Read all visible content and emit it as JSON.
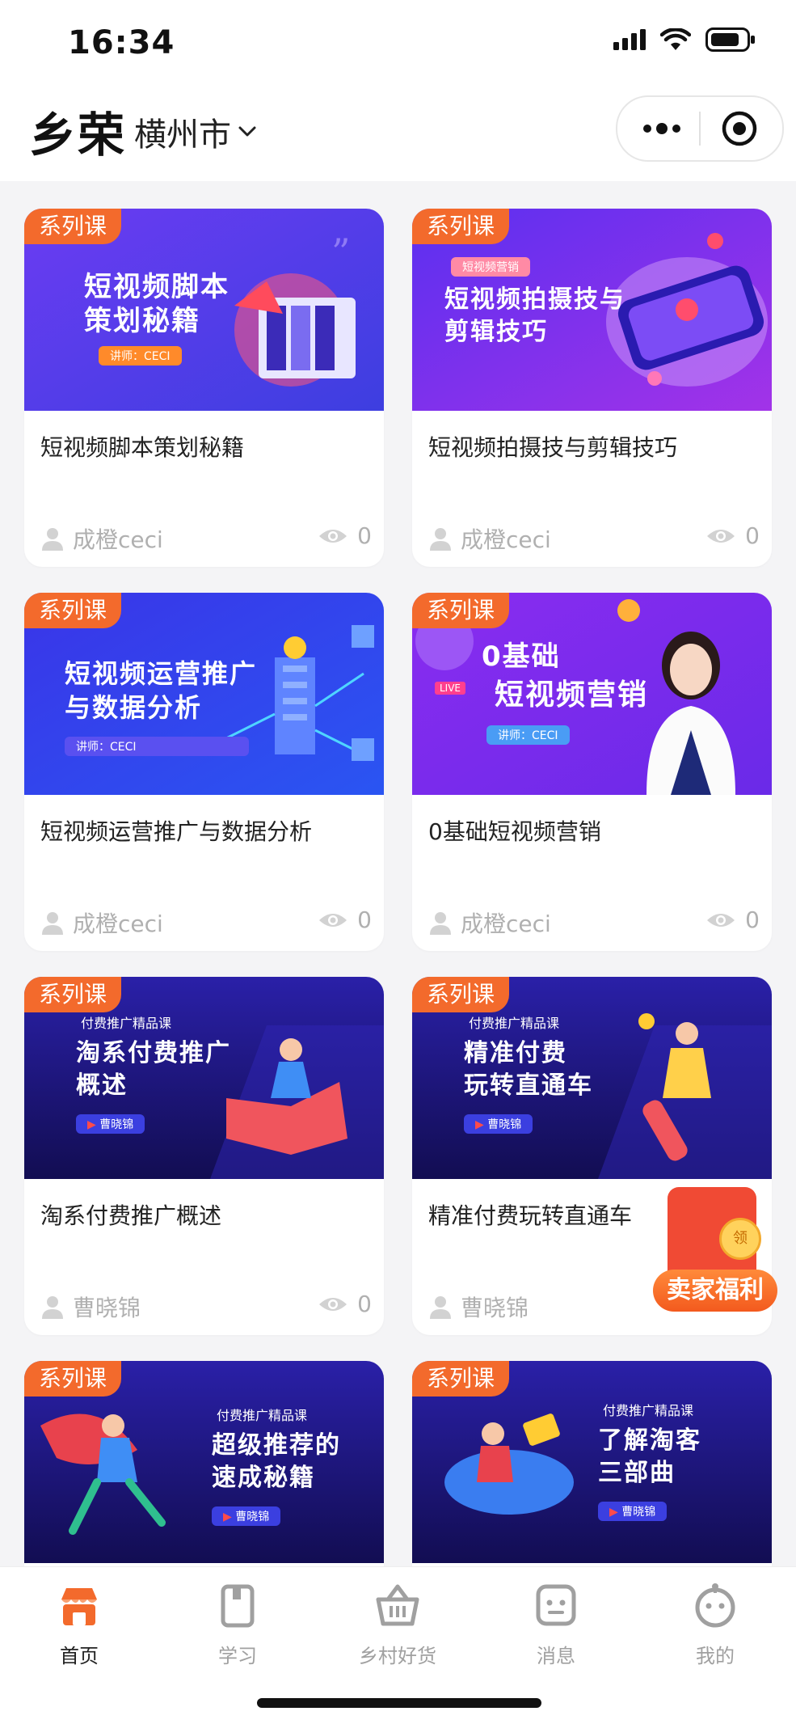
{
  "status_bar": {
    "time": "16:34"
  },
  "header": {
    "brand": "乡荣",
    "city": "横州市"
  },
  "courses": [
    {
      "tag": "系列课",
      "title": "短视频脚本策划秘籍",
      "author": "成橙ceci",
      "views": "0",
      "thumb": {
        "line1": "短视频脚本",
        "line2": "策划秘籍",
        "pill": "讲师：CECI"
      }
    },
    {
      "tag": "系列课",
      "title": "短视频拍摄技与剪辑技巧",
      "author": "成橙ceci",
      "views": "0",
      "thumb": {
        "pill": "短视频营销",
        "line1": "短视频拍摄技与",
        "line2": "剪辑技巧"
      }
    },
    {
      "tag": "系列课",
      "title": "短视频运营推广与数据分析",
      "author": "成橙ceci",
      "views": "0",
      "thumb": {
        "line1": "短视频运营推广",
        "line2": "与数据分析",
        "pill": "讲师：CECI"
      }
    },
    {
      "tag": "系列课",
      "title": "0基础短视频营销",
      "author": "成橙ceci",
      "views": "0",
      "thumb": {
        "line1": "0基础",
        "line2": "短视频营销",
        "pill": "讲师：CECI",
        "live": "LIVE"
      }
    },
    {
      "tag": "系列课",
      "title": "淘系付费推广概述",
      "author": "曹晓锦",
      "views": "0",
      "thumb": {
        "kicker": "付费推广精品课",
        "line1": "淘系付费推广",
        "line2": "概述",
        "pill": "曹晓锦"
      }
    },
    {
      "tag": "系列课",
      "title": "精准付费玩转直通车",
      "author": "曹晓锦",
      "views": "",
      "thumb": {
        "kicker": "付费推广精品课",
        "line1": "精准付费",
        "line2": "玩转直通车",
        "pill": "曹晓锦"
      }
    },
    {
      "tag": "系列课",
      "title": "",
      "author": "",
      "views": "",
      "thumb": {
        "kicker": "付费推广精品课",
        "line1": "超级推荐的",
        "line2": "速成秘籍",
        "pill": "曹晓锦"
      }
    },
    {
      "tag": "系列课",
      "title": "",
      "author": "",
      "views": "",
      "thumb": {
        "kicker": "付费推广精品课",
        "line1": "了解淘客",
        "line2": "三部曲",
        "pill": "曹晓锦"
      }
    }
  ],
  "welfare": {
    "label": "卖家福利",
    "coin": "领"
  },
  "tabbar": [
    {
      "label": "首页",
      "icon": "store-icon",
      "active": true
    },
    {
      "label": "学习",
      "icon": "book-icon",
      "active": false
    },
    {
      "label": "乡村好货",
      "icon": "basket-icon",
      "active": false
    },
    {
      "label": "消息",
      "icon": "message-icon",
      "active": false
    },
    {
      "label": "我的",
      "icon": "profile-icon",
      "active": false
    }
  ],
  "colors": {
    "tag": "#f36a2c",
    "purple": "#6a3df0",
    "navy": "#1a1570",
    "active_tab": "#f36a2c"
  }
}
